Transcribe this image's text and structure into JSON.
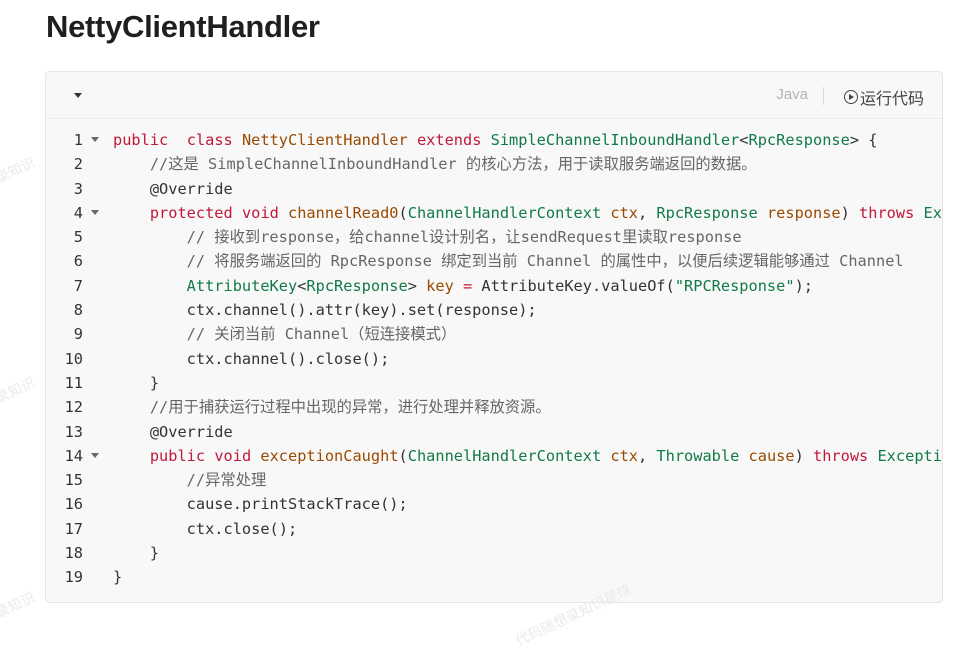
{
  "page": {
    "title": "NettyClientHandler"
  },
  "toolbar": {
    "language": "Java",
    "run_label": "运行代码"
  },
  "watermarks": [
    "录知识",
    "录知识",
    "录知识",
    "代码随想录知识星球"
  ],
  "code": {
    "lines": [
      {
        "n": "1",
        "fold": true,
        "t": [
          [
            "k",
            "public"
          ],
          [
            "",
            "  "
          ],
          [
            "k",
            "class"
          ],
          [
            "",
            ""
          ],
          [
            "v",
            " NettyClientHandler "
          ],
          [
            "k",
            "extends"
          ],
          [
            "t",
            " SimpleChannelInboundHandler"
          ],
          [
            "",
            "<"
          ],
          [
            "t",
            "RpcResponse"
          ],
          [
            "",
            "> {"
          ]
        ]
      },
      {
        "n": "2",
        "fold": false,
        "t": [
          [
            "c",
            "    //这是 SimpleChannelInboundHandler 的核心方法，用于读取服务端返回的数据。"
          ]
        ]
      },
      {
        "n": "3",
        "fold": false,
        "t": [
          [
            "",
            "    @Override"
          ]
        ]
      },
      {
        "n": "4",
        "fold": true,
        "t": [
          [
            "k",
            "    protected"
          ],
          [
            "k",
            " void"
          ],
          [
            "v",
            " channelRead0"
          ],
          [
            "",
            "("
          ],
          [
            "t",
            "ChannelHandlerContext"
          ],
          [
            "v",
            " ctx"
          ],
          [
            "",
            ", "
          ],
          [
            "t",
            "RpcResponse"
          ],
          [
            "v",
            " response"
          ],
          [
            "",
            ") "
          ],
          [
            "k",
            "throws"
          ],
          [
            "t",
            " Ex"
          ]
        ]
      },
      {
        "n": "5",
        "fold": false,
        "t": [
          [
            "c",
            "        // 接收到response，给channel设计别名，让sendRequest里读取response"
          ]
        ]
      },
      {
        "n": "6",
        "fold": false,
        "t": [
          [
            "c",
            "        // 将服务端返回的 RpcResponse 绑定到当前 Channel 的属性中，以便后续逻辑能够通过 Channel"
          ]
        ]
      },
      {
        "n": "7",
        "fold": false,
        "t": [
          [
            "t",
            "        AttributeKey"
          ],
          [
            "",
            "<"
          ],
          [
            "t",
            "RpcResponse"
          ],
          [
            "",
            "> "
          ],
          [
            "v",
            "key"
          ],
          [
            "k",
            " ="
          ],
          [
            "",
            " AttributeKey.valueOf("
          ],
          [
            "s",
            "\"RPCResponse\""
          ],
          [
            "",
            ");"
          ]
        ]
      },
      {
        "n": "8",
        "fold": false,
        "t": [
          [
            "",
            "        ctx.channel().attr(key).set(response);"
          ]
        ]
      },
      {
        "n": "9",
        "fold": false,
        "t": [
          [
            "c",
            "        // 关闭当前 Channel（短连接模式）"
          ]
        ]
      },
      {
        "n": "10",
        "fold": false,
        "t": [
          [
            "",
            "        ctx.channel().close();"
          ]
        ]
      },
      {
        "n": "11",
        "fold": false,
        "t": [
          [
            "",
            "    }"
          ]
        ]
      },
      {
        "n": "12",
        "fold": false,
        "t": [
          [
            "c",
            "    //用于捕获运行过程中出现的异常，进行处理并释放资源。"
          ]
        ]
      },
      {
        "n": "13",
        "fold": false,
        "t": [
          [
            "",
            "    @Override"
          ]
        ]
      },
      {
        "n": "14",
        "fold": true,
        "t": [
          [
            "k",
            "    public"
          ],
          [
            "k",
            " void"
          ],
          [
            "v",
            " exceptionCaught"
          ],
          [
            "",
            "("
          ],
          [
            "t",
            "ChannelHandlerContext"
          ],
          [
            "v",
            " ctx"
          ],
          [
            "",
            ", "
          ],
          [
            "t",
            "Throwable"
          ],
          [
            "v",
            " cause"
          ],
          [
            "",
            ") "
          ],
          [
            "k",
            "throws"
          ],
          [
            "t",
            " Excepti"
          ]
        ]
      },
      {
        "n": "15",
        "fold": false,
        "t": [
          [
            "c",
            "        //异常处理"
          ]
        ]
      },
      {
        "n": "16",
        "fold": false,
        "t": [
          [
            "",
            "        cause.printStackTrace();"
          ]
        ]
      },
      {
        "n": "17",
        "fold": false,
        "t": [
          [
            "",
            "        ctx.close();"
          ]
        ]
      },
      {
        "n": "18",
        "fold": false,
        "t": [
          [
            "",
            "    }"
          ]
        ]
      },
      {
        "n": "19",
        "fold": false,
        "t": [
          [
            "",
            "}"
          ]
        ]
      }
    ]
  },
  "colors": {
    "keyword": "#c0183a",
    "type": "#117a47",
    "string": "#117a47",
    "comment": "#666666",
    "identifier": "#9a4a00"
  }
}
